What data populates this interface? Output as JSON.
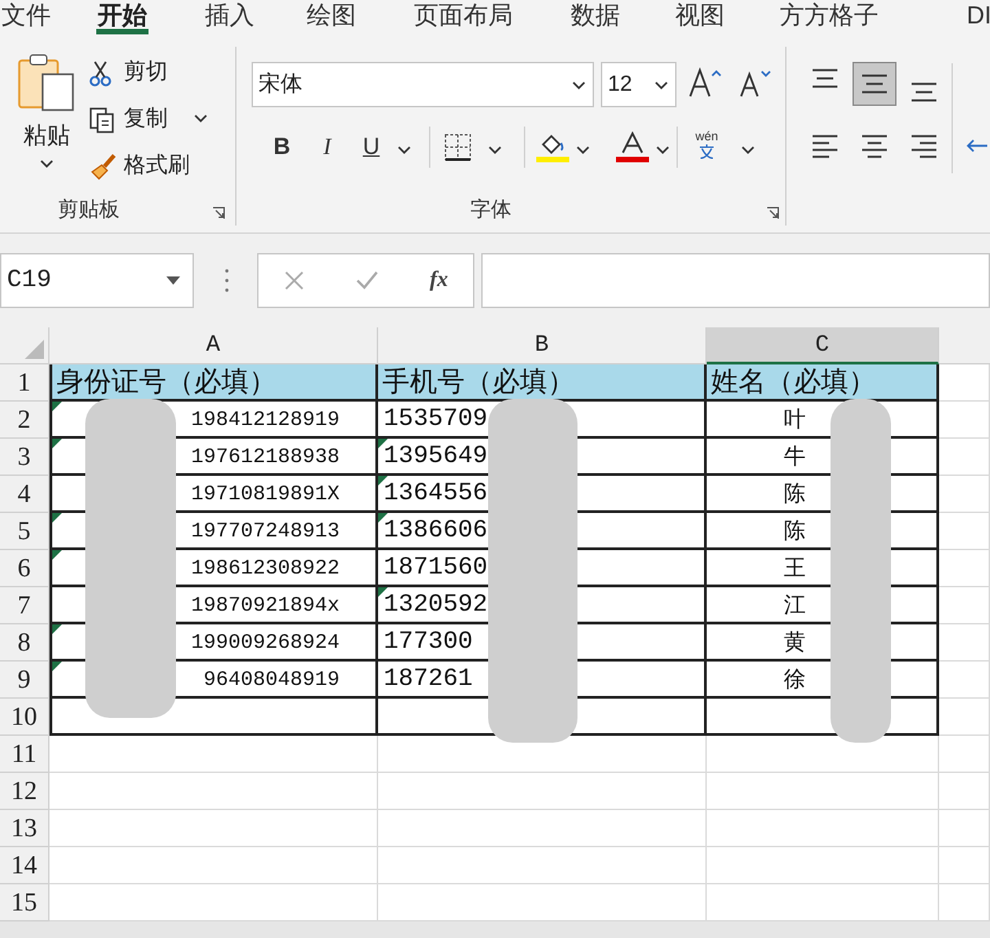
{
  "ribbon_tabs": [
    {
      "label": "文件",
      "selected": false
    },
    {
      "label": "开始",
      "selected": true
    },
    {
      "label": "插入",
      "selected": false
    },
    {
      "label": "绘图",
      "selected": false
    },
    {
      "label": "页面布局",
      "selected": false
    },
    {
      "label": "数据",
      "selected": false
    },
    {
      "label": "视图",
      "selected": false
    },
    {
      "label": "方方格子",
      "selected": false
    },
    {
      "label": "DI",
      "selected": false
    }
  ],
  "clipboard": {
    "paste": "粘贴",
    "cut": "剪切",
    "copy": "复制",
    "format_painter": "格式刷",
    "group_label": "剪贴板"
  },
  "font": {
    "name": "宋体",
    "size": "12",
    "bold": "B",
    "italic": "I",
    "underline": "U",
    "phonetic": "wén",
    "group_label": "字体"
  },
  "vertical_alignment": [
    {
      "selected": false
    },
    {
      "selected": true
    },
    {
      "selected": false
    }
  ],
  "formula_bar": {
    "name_box": "C19",
    "function_label": "fx"
  },
  "sheet": {
    "columns": [
      {
        "label": "A",
        "selected": false
      },
      {
        "label": "B",
        "selected": false
      },
      {
        "label": "C",
        "selected": true
      }
    ],
    "rows": [
      {
        "number": "1",
        "kind": "header",
        "cells": [
          {
            "text": "身份证号（必填）",
            "error_flag": false
          },
          {
            "text": "手机号（必填）",
            "error_flag": false
          },
          {
            "text": "姓名（必填）",
            "error_flag": false
          }
        ]
      },
      {
        "number": "2",
        "kind": "data",
        "cells": [
          {
            "text": "198412128919",
            "error_flag": true
          },
          {
            "text": "1535709",
            "error_flag": false
          },
          {
            "text": "叶",
            "error_flag": false
          }
        ]
      },
      {
        "number": "3",
        "kind": "data",
        "cells": [
          {
            "text": "197612188938",
            "error_flag": true
          },
          {
            "text": "1395649",
            "error_flag": true
          },
          {
            "text": "牛",
            "error_flag": false
          }
        ]
      },
      {
        "number": "4",
        "kind": "data",
        "cells": [
          {
            "text": "19710819891X",
            "error_flag": false
          },
          {
            "text": "1364556",
            "error_flag": true
          },
          {
            "text": "陈",
            "error_flag": false
          }
        ]
      },
      {
        "number": "5",
        "kind": "data",
        "cells": [
          {
            "text": "197707248913",
            "error_flag": true
          },
          {
            "text": "1386606",
            "error_flag": true
          },
          {
            "text": "陈",
            "error_flag": false
          }
        ]
      },
      {
        "number": "6",
        "kind": "data",
        "cells": [
          {
            "text": "198612308922",
            "error_flag": true
          },
          {
            "text": "1871560",
            "error_flag": false
          },
          {
            "text": "王",
            "error_flag": false
          }
        ]
      },
      {
        "number": "7",
        "kind": "data",
        "cells": [
          {
            "text": "19870921894x",
            "error_flag": false
          },
          {
            "text": "1320592",
            "error_flag": true
          },
          {
            "text": "江",
            "error_flag": false
          }
        ]
      },
      {
        "number": "8",
        "kind": "data",
        "cells": [
          {
            "text": "199009268924",
            "error_flag": true
          },
          {
            "text": "177300",
            "error_flag": false
          },
          {
            "text": "黄",
            "error_flag": false
          }
        ]
      },
      {
        "number": "9",
        "kind": "data",
        "cells": [
          {
            "text": "96408048919",
            "error_flag": true
          },
          {
            "text": "187261",
            "error_flag": false
          },
          {
            "text": "徐",
            "error_flag": false
          }
        ]
      },
      {
        "number": "10",
        "kind": "data",
        "cells": []
      },
      {
        "number": "11",
        "kind": "empty",
        "cells": []
      },
      {
        "number": "12",
        "kind": "empty",
        "cells": []
      },
      {
        "number": "13",
        "kind": "empty",
        "cells": []
      },
      {
        "number": "14",
        "kind": "empty",
        "cells": []
      },
      {
        "number": "15",
        "kind": "empty",
        "cells": []
      }
    ]
  }
}
